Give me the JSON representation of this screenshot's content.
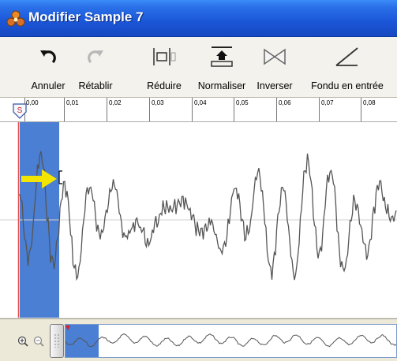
{
  "window": {
    "title": "Modifier Sample 7"
  },
  "toolbar": {
    "items": [
      {
        "label": "Annuler",
        "icon": "undo-icon",
        "enabled": true
      },
      {
        "label": "Rétablir",
        "icon": "redo-icon",
        "enabled": false
      },
      {
        "label": "Réduire",
        "icon": "trim-icon",
        "enabled": true
      },
      {
        "label": "Normaliser",
        "icon": "normalize-icon",
        "enabled": true
      },
      {
        "label": "Inverser",
        "icon": "reverse-icon",
        "enabled": true
      },
      {
        "label": "Fondu en entrée",
        "icon": "fade-in-icon",
        "enabled": true
      }
    ]
  },
  "ruler": {
    "labels": [
      "0,00",
      "0,01",
      "0,02",
      "0,03",
      "0,04",
      "0,05",
      "0,06",
      "0,07",
      "0,08"
    ],
    "start_marker": "S"
  },
  "colors": {
    "title_bar": "#1a56d8",
    "selection": "#4a7fd4",
    "waveform": "#555555",
    "playhead": "#e05050",
    "pointer_arrow": "#f2e600"
  }
}
